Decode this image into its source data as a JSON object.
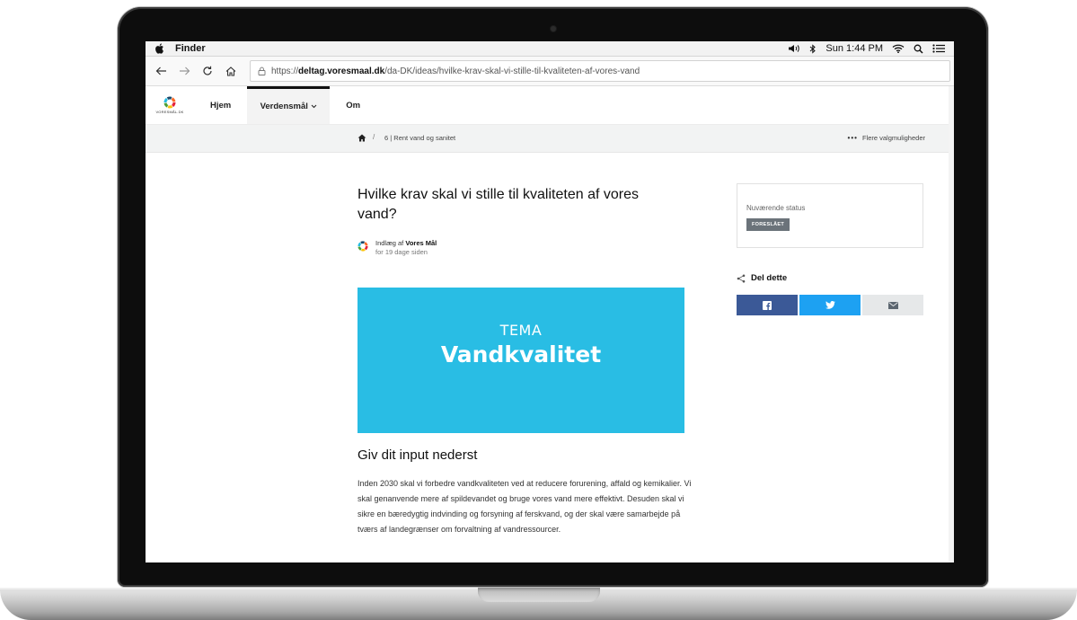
{
  "menubar": {
    "app_name": "Finder",
    "clock": "Sun 1:44 PM"
  },
  "browser": {
    "url_prefix": "https://",
    "url_domain": "deltag.voresmaal.dk",
    "url_path": "/da-DK/ideas/hvilke-krav-skal-vi-stille-til-kvaliteten-af-vores-vand"
  },
  "site_nav": {
    "logo_text": "VORESMÅL.DK",
    "items": [
      {
        "label": "Hjem"
      },
      {
        "label": "Verdensmål"
      },
      {
        "label": "Om"
      }
    ]
  },
  "breadcrumb": {
    "separator": "/",
    "current": "6 | Rent vand og sanitet",
    "more_label": "Flere valgmuligheder"
  },
  "article": {
    "title": "Hvilke krav skal vi stille til kvaliteten af vores vand?",
    "author_prefix": "Indlæg af",
    "author_name": "Vores Mål",
    "posted_ago": "for 19 dage siden",
    "hero_line1": "TEMA",
    "hero_line2": "Vandkvalitet",
    "subheading": "Giv dit input nederst",
    "body": "Inden 2030 skal vi forbedre vandkvaliteten ved at reducere forurening, affald og kemikalier. Vi skal genanvende mere af spildevandet og bruge vores vand mere effektivt. Desuden skal vi sikre en bæredygtig indvinding og forsyning af ferskvand, og der skal være samarbejde på tværs af landegrænser om forvaltning af vandressourcer."
  },
  "sidebar": {
    "status_label": "Nuværende status",
    "status_badge": "FORESLÅET",
    "share_label": "Del dette"
  },
  "colors": {
    "hero": "#29bde4",
    "facebook": "#3b5997",
    "twitter": "#1da1f2",
    "email": "#e6e8e9",
    "badge": "#6b737a"
  },
  "icons": [
    "apple-icon",
    "volume-icon",
    "bluetooth-icon",
    "wifi-icon",
    "search-icon",
    "list-icon",
    "back-icon",
    "forward-icon",
    "reload-icon",
    "home-icon",
    "lock-icon",
    "chevron-down-icon",
    "dots-icon",
    "share-icon",
    "facebook-icon",
    "twitter-icon",
    "email-icon"
  ]
}
